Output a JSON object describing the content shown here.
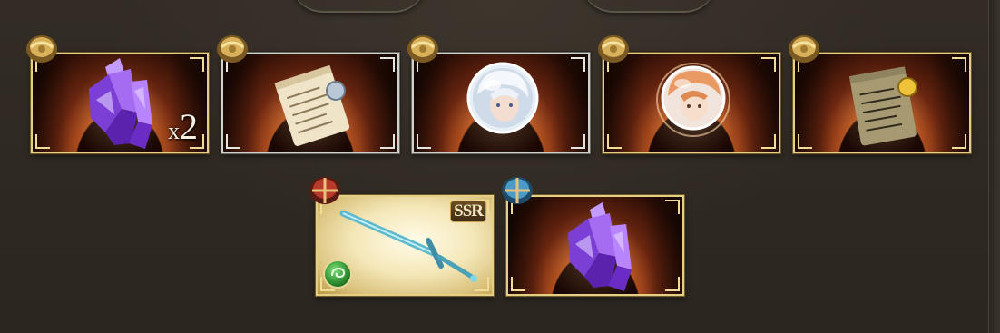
{
  "rewards": {
    "row1": [
      {
        "item": "crystal",
        "chest": "gold-chest-icon",
        "frame": "gold",
        "quantity_prefix": "x",
        "quantity_value": "2"
      },
      {
        "item": "ticket-silver-seal",
        "chest": "gold-chest-icon",
        "frame": "silver"
      },
      {
        "item": "character-orb-silver-hair",
        "chest": "gold-chest-icon",
        "frame": "silver"
      },
      {
        "item": "character-orb-orange-hair",
        "chest": "gold-chest-icon",
        "frame": "gold"
      },
      {
        "item": "ticket-gold-seal",
        "chest": "gold-chest-icon",
        "frame": "gold"
      }
    ],
    "row2": [
      {
        "item": "sword-weapon",
        "chest": "red-chest-icon",
        "frame": "gold",
        "rarity": "SSR",
        "element": "wind-element-icon"
      },
      {
        "item": "crystal",
        "chest": "blue-chest-icon",
        "frame": "gold"
      }
    ]
  },
  "labels": {
    "tile1_qty_prefix": "x",
    "tile1_qty_value": "2",
    "ssr_badge": "SSR"
  },
  "colors": {
    "background": "#2f2a23",
    "gold_frame": "#e5cf84",
    "silver_frame": "#d2d2cc",
    "crystal": "#9b5cf0",
    "sword_blade": "#7fd6e6"
  }
}
